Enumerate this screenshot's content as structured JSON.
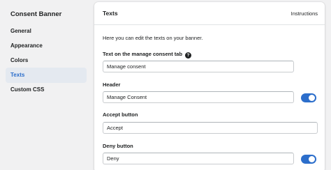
{
  "sidebar": {
    "title": "Consent Banner",
    "items": [
      {
        "label": "General",
        "active": false
      },
      {
        "label": "Appearance",
        "active": false
      },
      {
        "label": "Colors",
        "active": false
      },
      {
        "label": "Texts",
        "active": true
      },
      {
        "label": "Custom CSS",
        "active": false
      }
    ]
  },
  "panel": {
    "title": "Texts",
    "instructions_link": "Instructions",
    "intro": "Here you can edit the texts on your banner.",
    "fields": [
      {
        "label": "Text on the manage consent tab",
        "value": "Manage consent",
        "has_help_icon": true,
        "has_toggle": false
      },
      {
        "label": "Header",
        "value": "Manage Consent",
        "has_help_icon": false,
        "has_toggle": true,
        "toggle_on": true
      },
      {
        "label": "Accept button",
        "value": "Accept",
        "has_help_icon": false,
        "has_toggle": false
      },
      {
        "label": "Deny button",
        "value": "Deny",
        "has_help_icon": false,
        "has_toggle": true,
        "toggle_on": true
      }
    ]
  },
  "icons": {
    "help": "question-circle-icon",
    "help_glyph": "?"
  },
  "colors": {
    "accent": "#2c6ecb",
    "active_nav_bg": "#e4e9f0",
    "page_bg": "#f1f1f2"
  }
}
